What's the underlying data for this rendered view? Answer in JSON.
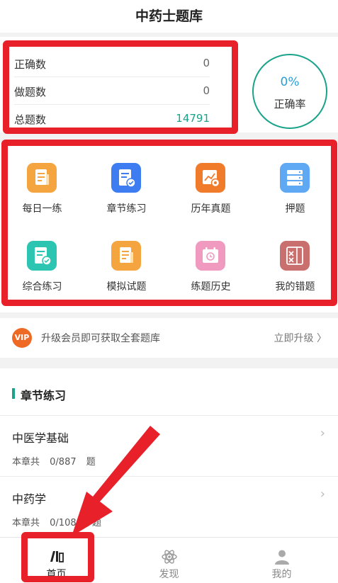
{
  "header": {
    "title": "中药士题库"
  },
  "stats": {
    "correct_label": "正确数",
    "correct_value": "0",
    "done_label": "做题数",
    "done_value": "0",
    "total_label": "总题数",
    "total_value": "14791",
    "rate_value": "0%",
    "rate_label": "正确率"
  },
  "grid": {
    "items": [
      {
        "label": "每日一练",
        "icon": "daily-practice-icon",
        "color": "#f4a53f"
      },
      {
        "label": "章节练习",
        "icon": "chapter-practice-icon",
        "color": "#3d7df1"
      },
      {
        "label": "历年真题",
        "icon": "past-exams-icon",
        "color": "#f07b2a"
      },
      {
        "label": "押题",
        "icon": "predicted-questions-icon",
        "color": "#5fa8f4"
      },
      {
        "label": "综合练习",
        "icon": "comprehensive-practice-icon",
        "color": "#2cc5b1"
      },
      {
        "label": "模拟试题",
        "icon": "mock-exam-icon",
        "color": "#f4a53f"
      },
      {
        "label": "练题历史",
        "icon": "practice-history-icon",
        "color": "#f09ac0"
      },
      {
        "label": "我的错题",
        "icon": "my-mistakes-icon",
        "color": "#c9706e"
      }
    ]
  },
  "vip": {
    "logo_text": "VIP",
    "text": "升级会员即可获取全套题库",
    "action": "立即升级 〉"
  },
  "chapters": {
    "section_title": "章节练习",
    "items": [
      {
        "name": "中医学基础",
        "prefix": "本章共",
        "count": "0/887",
        "unit": "题"
      },
      {
        "name": "中药学",
        "prefix": "本章共",
        "count": "0/1088",
        "unit": "题"
      }
    ],
    "arrow": "›"
  },
  "tabbar": {
    "items": [
      {
        "label": "首页",
        "icon": "home-books-icon",
        "active": true
      },
      {
        "label": "发现",
        "icon": "discover-atom-icon",
        "active": false
      },
      {
        "label": "我的",
        "icon": "profile-person-icon",
        "active": false
      }
    ]
  },
  "colors": {
    "accent": "#1aa38a",
    "rate_text": "#2a9fd6",
    "annotation_red": "#e8202a"
  }
}
